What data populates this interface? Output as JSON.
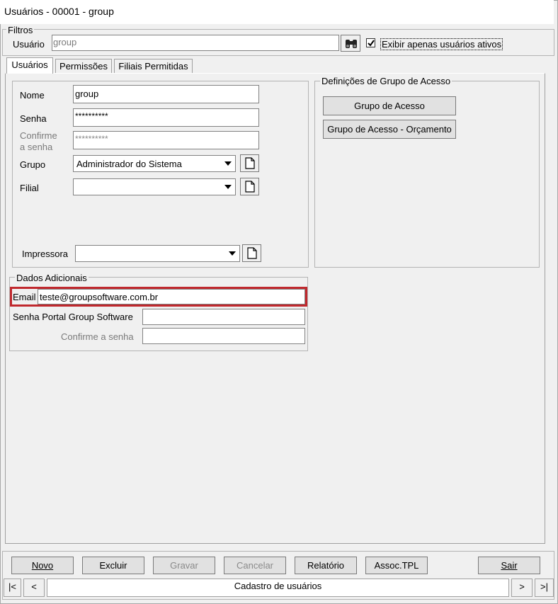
{
  "window": {
    "title": "Usuários - 00001 - group"
  },
  "filters": {
    "legend": "Filtros",
    "user_label": "Usuário",
    "user_value": "group",
    "only_active_label": "Exibir apenas usuários ativos",
    "only_active_checked": true
  },
  "tabs": [
    {
      "label": "Usuários",
      "active": true
    },
    {
      "label": "Permissões",
      "active": false
    },
    {
      "label": "Filiais Permitidas",
      "active": false
    }
  ],
  "form": {
    "name_label": "Nome",
    "name_value": "group",
    "password_label": "Senha",
    "password_value": "**********",
    "confirm_label_line1": "Confirme",
    "confirm_label_line2": "a senha",
    "confirm_value": "**********",
    "group_label": "Grupo",
    "group_value": "Administrador do Sistema",
    "branch_label": "Filial",
    "branch_value": "",
    "printer_label": "Impressora",
    "printer_value": ""
  },
  "access_group": {
    "legend": "Definições de Grupo de Acesso",
    "btn_access_group": "Grupo de Acesso",
    "btn_access_group_budget": "Grupo de Acesso - Orçamento"
  },
  "additional": {
    "legend": "Dados Adicionais",
    "email_label": "Email",
    "email_value": "teste@groupsoftware.com.br",
    "portal_password_label": "Senha Portal Group Software",
    "portal_password_value": "",
    "portal_confirm_label": "Confirme a senha",
    "portal_confirm_value": ""
  },
  "toolbar": {
    "new": "Novo",
    "delete": "Excluir",
    "save": "Gravar",
    "cancel": "Cancelar",
    "report": "Relatório",
    "assoc": "Assoc.TPL",
    "exit": "Sair"
  },
  "navigator": {
    "first": "|<",
    "prev": "<",
    "caption": "Cadastro de usuários",
    "next": ">",
    "last": ">|"
  },
  "colors": {
    "highlight_border": "#c0282d"
  }
}
